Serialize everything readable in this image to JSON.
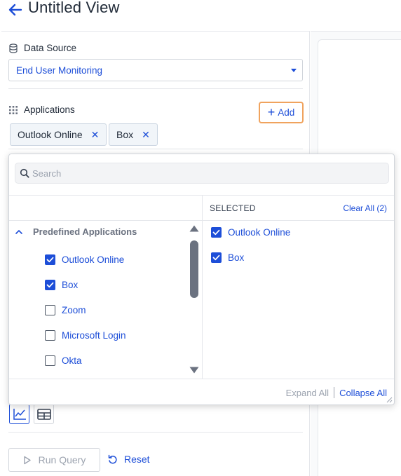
{
  "header": {
    "title": "Untitled View"
  },
  "data_source": {
    "label": "Data Source",
    "value": "End User Monitoring"
  },
  "applications": {
    "label": "Applications",
    "add_label": "Add",
    "chips": [
      {
        "label": "Outlook Online"
      },
      {
        "label": "Box"
      }
    ]
  },
  "dropdown": {
    "search_placeholder": "Search",
    "selected_header": "SELECTED",
    "clear_all": "Clear All (2)",
    "group_label": "Predefined Applications",
    "options": [
      {
        "label": "Outlook Online",
        "checked": true
      },
      {
        "label": "Box",
        "checked": true
      },
      {
        "label": "Zoom",
        "checked": false
      },
      {
        "label": "Microsoft Login",
        "checked": false
      },
      {
        "label": "Okta",
        "checked": false
      }
    ],
    "selected_items": [
      {
        "label": "Outlook Online"
      },
      {
        "label": "Box"
      }
    ],
    "expand_all": "Expand All",
    "collapse_all": "Collapse All"
  },
  "actions": {
    "run_query": "Run Query",
    "reset": "Reset"
  },
  "colors": {
    "accent": "#1d4ed8",
    "focus_border": "#f0a35e",
    "muted": "#9ca3af"
  }
}
